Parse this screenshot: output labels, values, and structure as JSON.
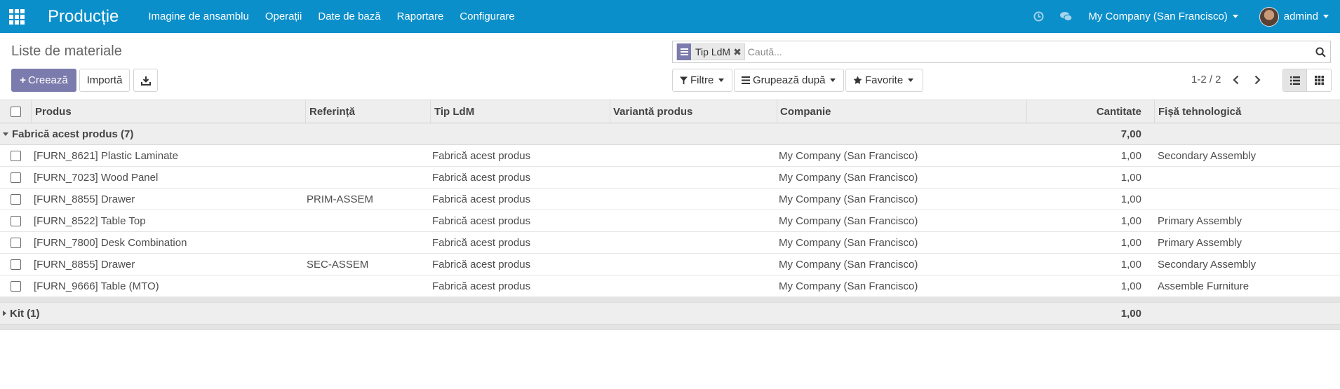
{
  "navbar": {
    "app_title": "Producție",
    "menu": [
      "Imagine de ansamblu",
      "Operații",
      "Date de bază",
      "Raportare",
      "Configurare"
    ],
    "company": "My Company (San Francisco)",
    "user": "admind",
    "bg_color": "#0b8fcb"
  },
  "control_panel": {
    "title": "Liste de materiale",
    "create_label": "Creează",
    "import_label": "Importă",
    "search": {
      "facet_value": "Tip LdM",
      "placeholder": "Caută..."
    },
    "filters_label": "Filtre",
    "groupby_label": "Grupează după",
    "favorites_label": "Favorite",
    "pager": "1-2 / 2",
    "accent_color": "#7c7bad"
  },
  "table": {
    "columns": [
      "Produs",
      "Referință",
      "Tip LdM",
      "Variantă produs",
      "Companie",
      "Cantitate",
      "Fișă tehnologică"
    ],
    "groups": [
      {
        "label": "Fabrică acest produs (7)",
        "quantity": "7,00",
        "expanded": true,
        "rows": [
          {
            "product": "[FURN_8621] Plastic Laminate",
            "reference": "",
            "type": "Fabrică acest produs",
            "variant": "",
            "company": "My Company (San Francisco)",
            "quantity": "1,00",
            "routing": "Secondary Assembly"
          },
          {
            "product": "[FURN_7023] Wood Panel",
            "reference": "",
            "type": "Fabrică acest produs",
            "variant": "",
            "company": "My Company (San Francisco)",
            "quantity": "1,00",
            "routing": ""
          },
          {
            "product": "[FURN_8855] Drawer",
            "reference": "PRIM-ASSEM",
            "type": "Fabrică acest produs",
            "variant": "",
            "company": "My Company (San Francisco)",
            "quantity": "1,00",
            "routing": ""
          },
          {
            "product": "[FURN_8522] Table Top",
            "reference": "",
            "type": "Fabrică acest produs",
            "variant": "",
            "company": "My Company (San Francisco)",
            "quantity": "1,00",
            "routing": "Primary Assembly"
          },
          {
            "product": "[FURN_7800] Desk Combination",
            "reference": "",
            "type": "Fabrică acest produs",
            "variant": "",
            "company": "My Company (San Francisco)",
            "quantity": "1,00",
            "routing": "Primary Assembly"
          },
          {
            "product": "[FURN_8855] Drawer",
            "reference": "SEC-ASSEM",
            "type": "Fabrică acest produs",
            "variant": "",
            "company": "My Company (San Francisco)",
            "quantity": "1,00",
            "routing": "Secondary Assembly"
          },
          {
            "product": "[FURN_9666] Table (MTO)",
            "reference": "",
            "type": "Fabrică acest produs",
            "variant": "",
            "company": "My Company (San Francisco)",
            "quantity": "1,00",
            "routing": "Assemble Furniture"
          }
        ]
      },
      {
        "label": "Kit (1)",
        "quantity": "1,00",
        "expanded": false,
        "rows": []
      }
    ]
  }
}
